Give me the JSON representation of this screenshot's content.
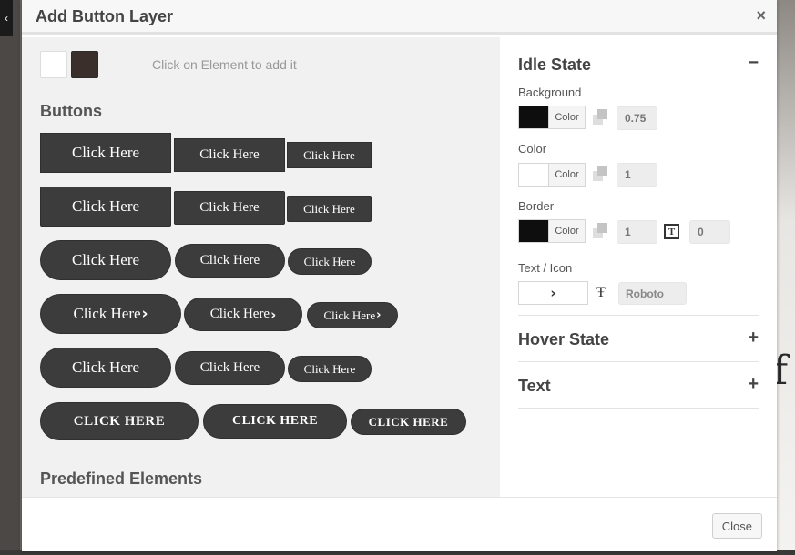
{
  "dialog": {
    "title": "Add Button Layer",
    "close_glyph": "×",
    "footer_close_label": "Close"
  },
  "left": {
    "hint": "Click on Element to add it",
    "buttons_heading": "Buttons",
    "predefined_heading": "Predefined Elements",
    "button_text": "Click Here",
    "button_text_caps": "CLICK HERE",
    "chevron_glyph": "›"
  },
  "right": {
    "idle_state": {
      "title": "Idle State",
      "toggle": "−",
      "background": {
        "label": "Background",
        "swatch_color": "#0e0e0e",
        "color_label": "Color",
        "opacity": "0.75"
      },
      "color": {
        "label": "Color",
        "swatch_color": "#ffffff",
        "color_label": "Color",
        "opacity": "1"
      },
      "border": {
        "label": "Border",
        "swatch_color": "#0e0e0e",
        "color_label": "Color",
        "width": "1",
        "radius": "0",
        "radius_glyph": "T"
      },
      "text_icon": {
        "label": "Text / Icon",
        "icon_glyph": "›",
        "font_glyph": "Ŧ",
        "font": "Roboto"
      }
    },
    "hover_state": {
      "title": "Hover State",
      "toggle": "+"
    },
    "text_section": {
      "title": "Text",
      "toggle": "+"
    }
  },
  "colors": {
    "button_bg": "#3c3c3c",
    "pane_bg": "#f1f1f1",
    "swatch_dark": "#3a2f2b"
  },
  "backdrop": {
    "letter": "f"
  }
}
